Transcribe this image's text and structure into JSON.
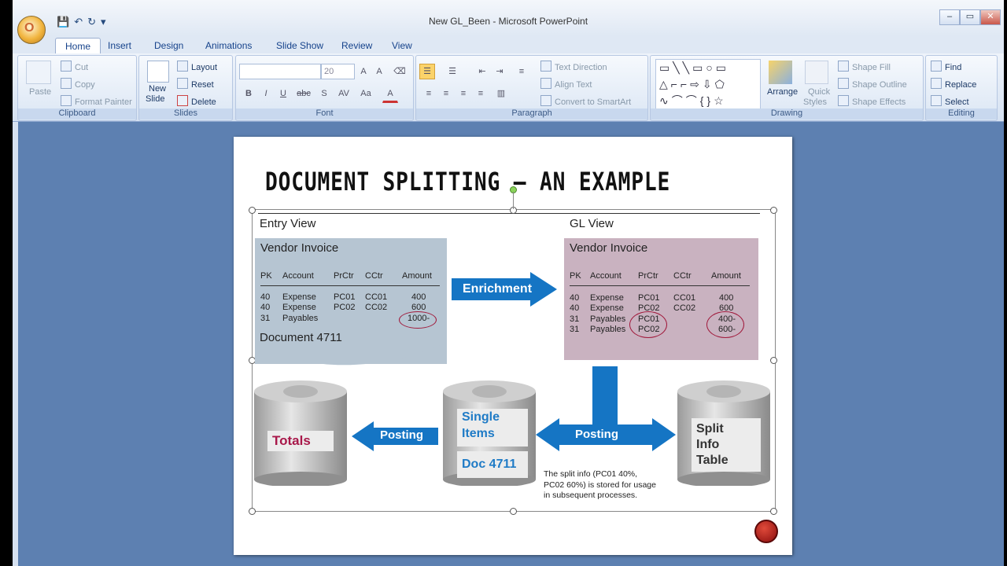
{
  "app": {
    "title": "New GL_Been - Microsoft PowerPoint",
    "office_button": "O"
  },
  "qat": {
    "save": "💾",
    "undo": "↶",
    "redo": "↻",
    "more": "▾"
  },
  "window_controls": {
    "minimize": "–",
    "restore": "▭",
    "close": "✕"
  },
  "tabs": [
    "Home",
    "Insert",
    "Design",
    "Animations",
    "Slide Show",
    "Review",
    "View"
  ],
  "ribbon": {
    "clipboard": {
      "label": "Clipboard",
      "paste": "Paste",
      "cut": "Cut",
      "copy": "Copy",
      "format_painter": "Format Painter"
    },
    "slides": {
      "label": "Slides",
      "new_slide_line1": "New",
      "new_slide_line2": "Slide",
      "layout": "Layout",
      "reset": "Reset",
      "delete": "Delete"
    },
    "font": {
      "label": "Font",
      "font_size": "20",
      "font_name": ""
    },
    "paragraph": {
      "label": "Paragraph",
      "text_direction": "Text Direction",
      "align_text": "Align Text",
      "convert_smartart": "Convert to SmartArt"
    },
    "drawing": {
      "label": "Drawing",
      "arrange": "Arrange",
      "quick_styles_1": "Quick",
      "quick_styles_2": "Styles",
      "shape_fill": "Shape Fill",
      "shape_outline": "Shape Outline",
      "shape_effects": "Shape Effects"
    },
    "editing": {
      "label": "Editing",
      "find": "Find",
      "replace": "Replace",
      "select": "Select"
    }
  },
  "slide": {
    "title": "DOCUMENT SPLITTING – AN EXAMPLE",
    "entry_view": "Entry View",
    "gl_view": "GL View",
    "left": {
      "heading": "Vendor Invoice",
      "columns": [
        "PK",
        "Account",
        "PrCtr",
        "CCtr",
        "Amount"
      ],
      "rows": [
        [
          "40",
          "Expense",
          "PC01",
          "CC01",
          "400"
        ],
        [
          "40",
          "Expense",
          "PC02",
          "CC02",
          "600"
        ],
        [
          "31",
          "Payables",
          "",
          "",
          "1000-"
        ]
      ],
      "document": "Document  4711"
    },
    "right": {
      "heading": "Vendor Invoice",
      "columns": [
        "PK",
        "Account",
        "PrCtr",
        "CCtr",
        "Amount"
      ],
      "rows": [
        [
          "40",
          "Expense",
          "PC01",
          "CC01",
          "400"
        ],
        [
          "40",
          "Expense",
          "PC02",
          "CC02",
          "600"
        ],
        [
          "31",
          "Payables",
          "PC01",
          "",
          "400-"
        ],
        [
          "31",
          "Payables",
          "PC02",
          "",
          "600-"
        ]
      ]
    },
    "enrichment": "Enrichment",
    "posting_left": "Posting",
    "posting_right": "Posting",
    "totals": "Totals",
    "single_items_1": "Single",
    "single_items_2": "Items",
    "doc": "Doc 4711",
    "split_1": "Split",
    "split_2": "Info",
    "split_3": "Table",
    "note_1": "The split info (PC01 40%,",
    "note_2": "PC02 60%) is stored for usage",
    "note_3": "in subsequent processes."
  }
}
